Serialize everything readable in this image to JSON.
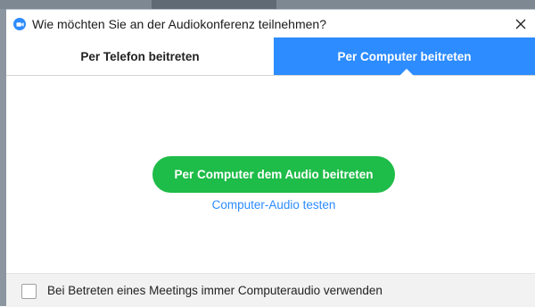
{
  "dialog": {
    "title": "Wie möchten Sie an der Audiokonferenz teilnehmen?",
    "icon": "camera-icon",
    "accent_color": "#2d8cff"
  },
  "tabs": [
    {
      "label": "Per Telefon beitreten",
      "selected": false
    },
    {
      "label": "Per Computer beitreten",
      "selected": true
    }
  ],
  "main": {
    "join_button_label": "Per Computer dem Audio beitreten",
    "join_button_color": "#1ebc48",
    "test_link_label": "Computer-Audio testen"
  },
  "footer": {
    "checkbox_label": "Bei Betreten eines Meetings immer Computeraudio verwenden",
    "checkbox_checked": false
  }
}
